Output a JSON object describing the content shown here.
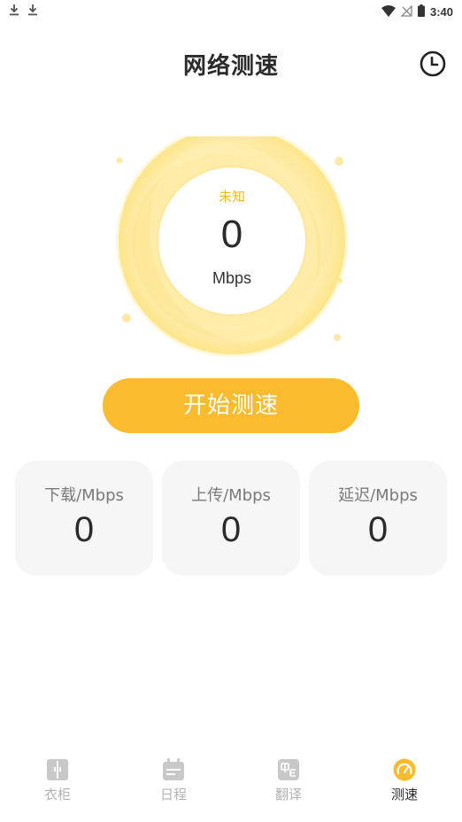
{
  "status_bar": {
    "time": "3:40",
    "left_icons": [
      "download-icon",
      "download-icon"
    ],
    "right_icons": [
      "wifi-icon",
      "no-sim-icon",
      "battery-icon"
    ]
  },
  "header": {
    "title": "网络测速",
    "history_icon": "clock-icon"
  },
  "gauge": {
    "status": "未知",
    "value": "0",
    "unit": "Mbps",
    "accent_color": "#f5b52b"
  },
  "start_button": {
    "label": "开始测速",
    "color": "#fbbb2e"
  },
  "stats": [
    {
      "label": "下载/Mbps",
      "value": "0"
    },
    {
      "label": "上传/Mbps",
      "value": "0"
    },
    {
      "label": "延迟/Mbps",
      "value": "0"
    }
  ],
  "tabs": [
    {
      "label": "衣柜",
      "icon": "wardrobe-icon",
      "active": false
    },
    {
      "label": "日程",
      "icon": "calendar-icon",
      "active": false
    },
    {
      "label": "翻译",
      "icon": "translate-icon",
      "active": false
    },
    {
      "label": "测速",
      "icon": "speedometer-icon",
      "active": true
    }
  ],
  "colors": {
    "accent": "#fbbb2e",
    "inactive_tab": "#c8c8c8",
    "text": "#2b2b2b"
  }
}
